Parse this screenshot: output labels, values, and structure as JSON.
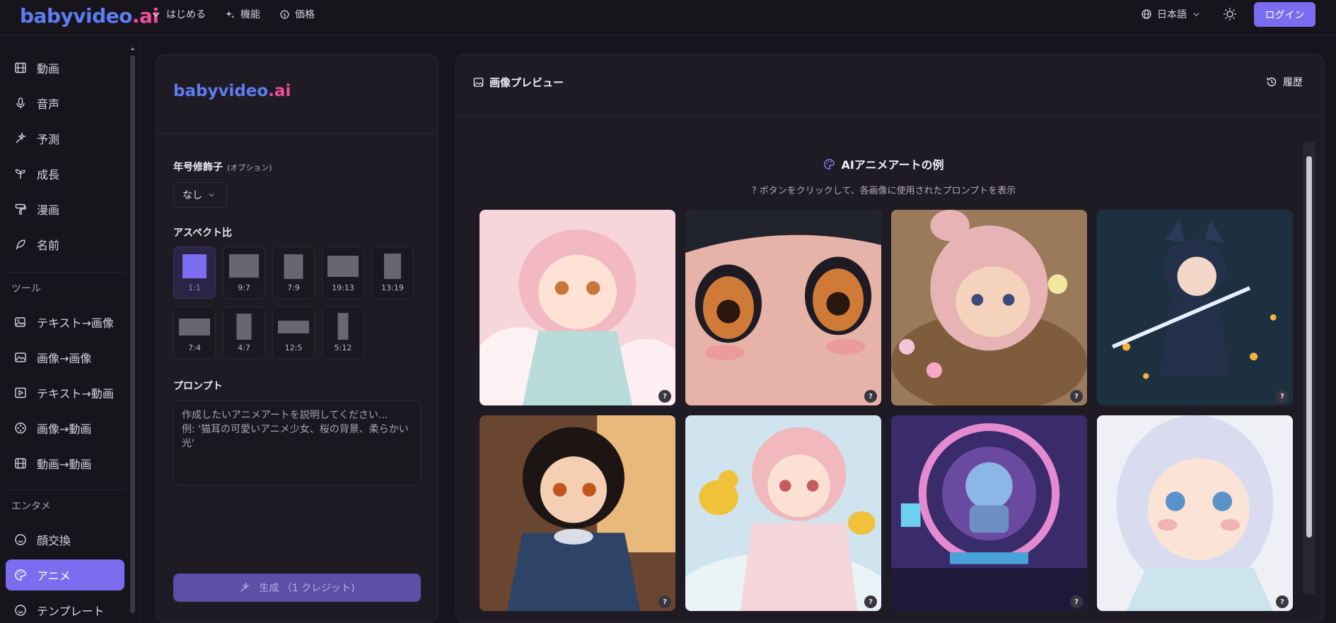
{
  "brand": {
    "name_part1": "babyvideo",
    "name_part2": ".ai"
  },
  "topnav": [
    {
      "label": "はじめる",
      "icon": "chevron-down-icon"
    },
    {
      "label": "機能",
      "icon": "sparkles-icon"
    },
    {
      "label": "価格",
      "icon": "coin-icon"
    }
  ],
  "language": "日本語",
  "login_label": "ログイン",
  "sidebar": {
    "items": [
      {
        "label": "動画",
        "icon": "film-icon"
      },
      {
        "label": "音声",
        "icon": "mic-icon"
      },
      {
        "label": "予測",
        "icon": "wand-icon"
      },
      {
        "label": "成長",
        "icon": "sprout-icon"
      },
      {
        "label": "漫画",
        "icon": "paint-roller-icon"
      },
      {
        "label": "名前",
        "icon": "feather-icon"
      }
    ],
    "tools_heading": "ツール",
    "tools": [
      {
        "label": "テキスト→画像",
        "icon": "image-plus-icon"
      },
      {
        "label": "画像→画像",
        "icon": "image-icon"
      },
      {
        "label": "テキスト→動画",
        "icon": "play-square-icon"
      },
      {
        "label": "画像→動画",
        "icon": "film-reel-icon"
      },
      {
        "label": "動画→動画",
        "icon": "film-icon"
      }
    ],
    "ent_heading": "エンタメ",
    "ent": [
      {
        "label": "顔交換",
        "icon": "smile-icon"
      },
      {
        "label": "アニメ",
        "icon": "palette-icon",
        "active": true
      },
      {
        "label": "テンプレート",
        "icon": "smile-icon"
      }
    ]
  },
  "settings": {
    "era_label": "年号修飾子",
    "era_optional": "(オプション)",
    "era_value": "なし",
    "aspect_label": "アスペクト比",
    "ratios": [
      "1:1",
      "9:7",
      "7:9",
      "19:13",
      "13:19",
      "7:4",
      "4:7",
      "12:5",
      "5:12"
    ],
    "selected_ratio": "1:1",
    "prompt_label": "プロンプト",
    "prompt_placeholder": "作成したいアニメアートを説明してください...\n例: '猫耳の可愛いアニメ少女、桜の背景、柔らかい光'",
    "generate_label": "生成 （1 クレジット)"
  },
  "preview": {
    "title": "画像プレビュー",
    "history_label": "履歴",
    "gallery_title": "AIアニメアートの例",
    "gallery_subtitle": "? ボタンをクリックして、各画像に使用されたプロンプトを表示",
    "help_glyph": "?",
    "colors": {
      "tile1": "#f6d6db",
      "tile2": "#e7b3a8",
      "tile3": "#9a7a5a",
      "tile4": "#1d3040",
      "tile5": "#6a4630",
      "tile6": "#cfe4ee",
      "tile7": "#3a2b6a",
      "tile8": "#eef0f6"
    }
  }
}
